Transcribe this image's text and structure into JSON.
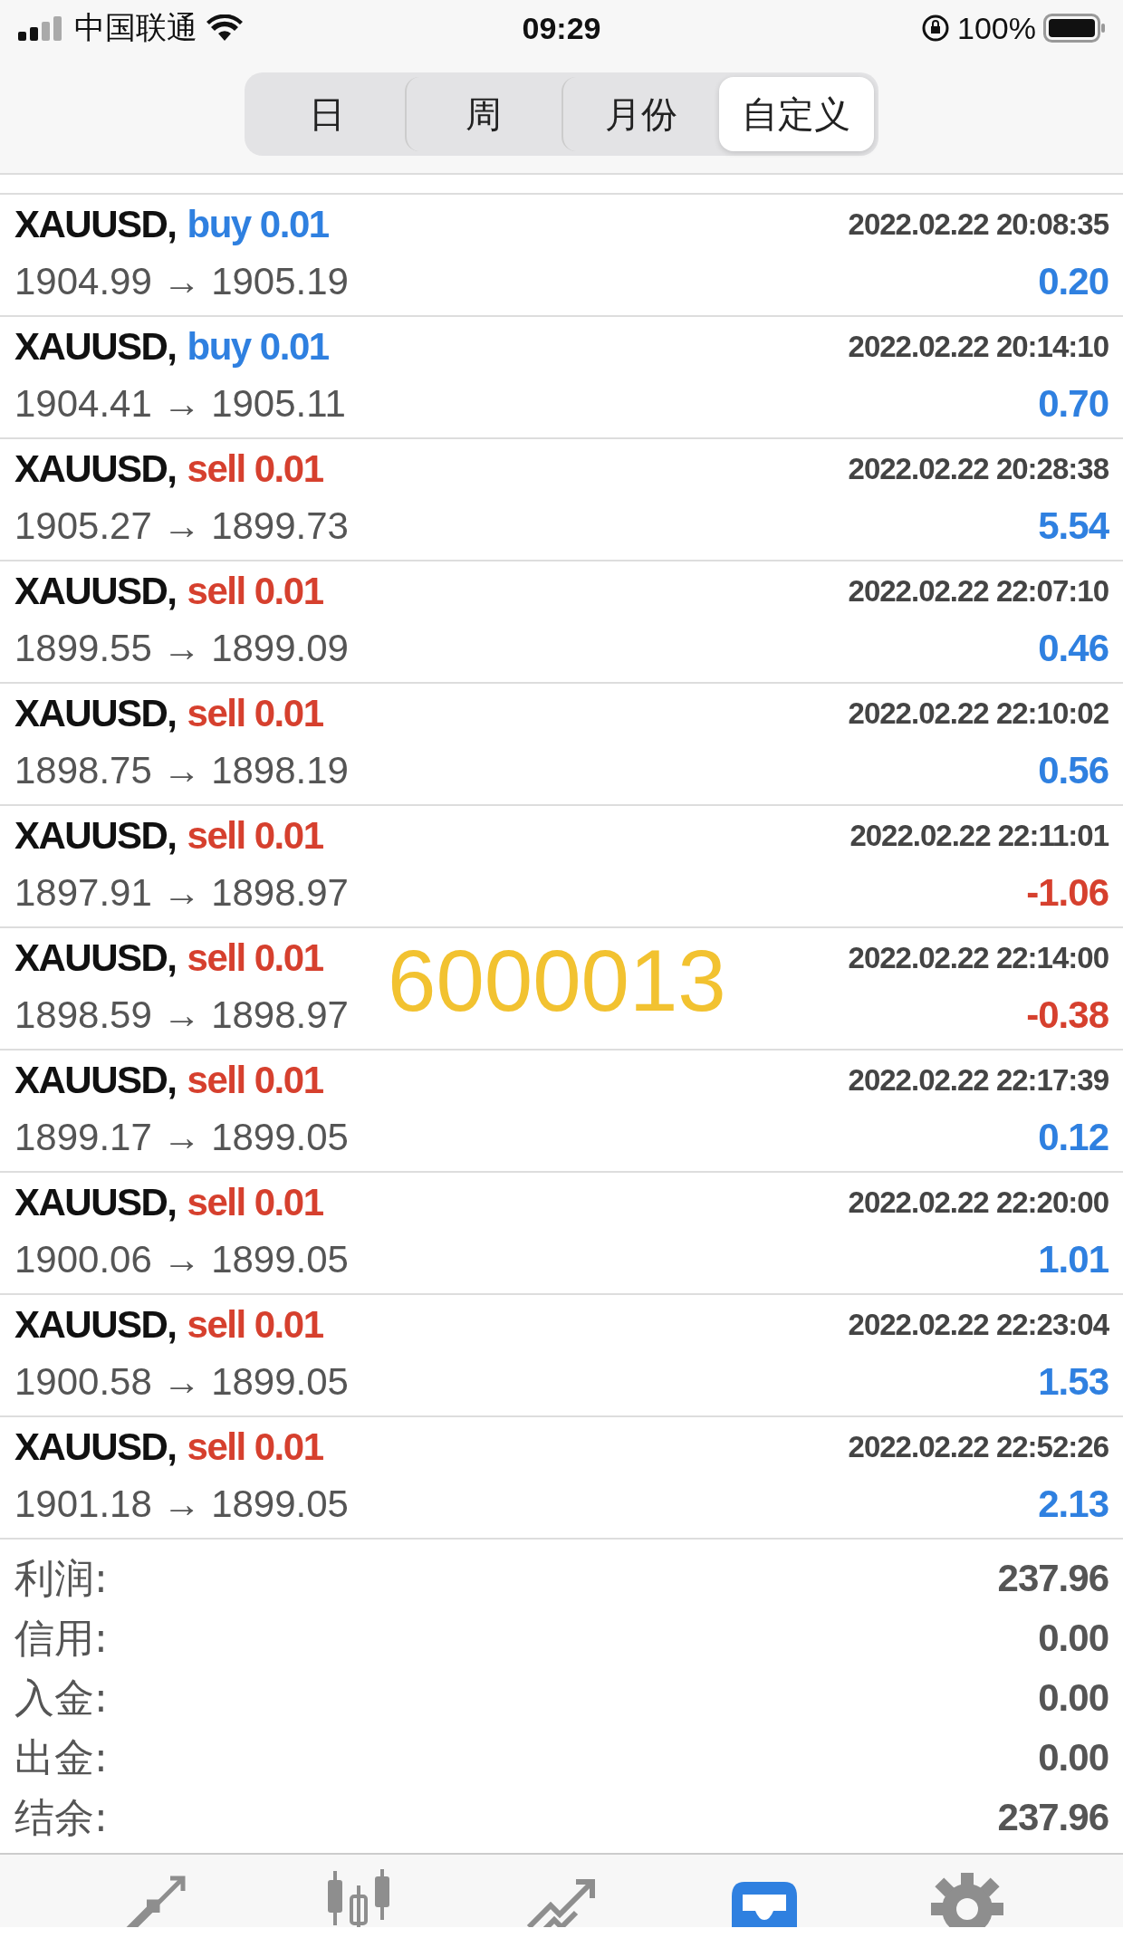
{
  "status_bar": {
    "carrier": "中国联通",
    "time": "09:29",
    "battery": "100%"
  },
  "tabs": [
    {
      "label": "日",
      "selected": false
    },
    {
      "label": "周",
      "selected": false
    },
    {
      "label": "月份",
      "selected": false
    },
    {
      "label": "自定义",
      "selected": true
    }
  ],
  "trades": [
    {
      "symbol": "XAUUSD,",
      "kind": "buy",
      "order": "buy 0.01",
      "time": "2022.02.22 20:08:35",
      "prices": "1904.99 → 1905.19",
      "profit": "0.20",
      "loss": false
    },
    {
      "symbol": "XAUUSD,",
      "kind": "buy",
      "order": "buy 0.01",
      "time": "2022.02.22 20:14:10",
      "prices": "1904.41 → 1905.11",
      "profit": "0.70",
      "loss": false
    },
    {
      "symbol": "XAUUSD,",
      "kind": "sell",
      "order": "sell 0.01",
      "time": "2022.02.22 20:28:38",
      "prices": "1905.27 → 1899.73",
      "profit": "5.54",
      "loss": false
    },
    {
      "symbol": "XAUUSD,",
      "kind": "sell",
      "order": "sell 0.01",
      "time": "2022.02.22 22:07:10",
      "prices": "1899.55 → 1899.09",
      "profit": "0.46",
      "loss": false
    },
    {
      "symbol": "XAUUSD,",
      "kind": "sell",
      "order": "sell 0.01",
      "time": "2022.02.22 22:10:02",
      "prices": "1898.75 → 1898.19",
      "profit": "0.56",
      "loss": false
    },
    {
      "symbol": "XAUUSD,",
      "kind": "sell",
      "order": "sell 0.01",
      "time": "2022.02.22 22:11:01",
      "prices": "1897.91 → 1898.97",
      "profit": "-1.06",
      "loss": true
    },
    {
      "symbol": "XAUUSD,",
      "kind": "sell",
      "order": "sell 0.01",
      "time": "2022.02.22 22:14:00",
      "prices": "1898.59 → 1898.97",
      "profit": "-0.38",
      "loss": true
    },
    {
      "symbol": "XAUUSD,",
      "kind": "sell",
      "order": "sell 0.01",
      "time": "2022.02.22 22:17:39",
      "prices": "1899.17 → 1899.05",
      "profit": "0.12",
      "loss": false
    },
    {
      "symbol": "XAUUSD,",
      "kind": "sell",
      "order": "sell 0.01",
      "time": "2022.02.22 22:20:00",
      "prices": "1900.06 → 1899.05",
      "profit": "1.01",
      "loss": false
    },
    {
      "symbol": "XAUUSD,",
      "kind": "sell",
      "order": "sell 0.01",
      "time": "2022.02.22 22:23:04",
      "prices": "1900.58 → 1899.05",
      "profit": "1.53",
      "loss": false
    },
    {
      "symbol": "XAUUSD,",
      "kind": "sell",
      "order": "sell 0.01",
      "time": "2022.02.22 22:52:26",
      "prices": "1901.18 → 1899.05",
      "profit": "2.13",
      "loss": false
    }
  ],
  "overlay_number": "6000013",
  "summary": [
    {
      "label": "利润:",
      "value": "237.96"
    },
    {
      "label": "信用:",
      "value": "0.00"
    },
    {
      "label": "入金:",
      "value": "0.00"
    },
    {
      "label": "出金:",
      "value": "0.00"
    },
    {
      "label": "结余:",
      "value": "237.96"
    }
  ],
  "nav": [
    {
      "kind": "trade",
      "selected": false
    },
    {
      "kind": "chart",
      "selected": false
    },
    {
      "kind": "trend",
      "selected": false
    },
    {
      "kind": "history",
      "selected": true
    },
    {
      "kind": "settings",
      "selected": false
    }
  ]
}
